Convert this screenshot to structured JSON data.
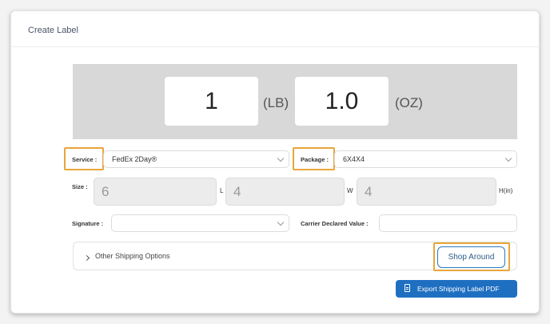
{
  "card": {
    "title": "Create Label"
  },
  "weight": {
    "lb_value": "1",
    "lb_unit": "(LB)",
    "oz_value": "1.0",
    "oz_unit": "(OZ)"
  },
  "service": {
    "label": "Service :",
    "value": "FedEx 2Day®"
  },
  "package": {
    "label": "Package :",
    "value": "6X4X4"
  },
  "size": {
    "label": "Size :",
    "length": "6",
    "length_unit": "L",
    "width": "4",
    "width_unit": "W",
    "height": "4",
    "height_unit": "H(in)"
  },
  "signature": {
    "label": "Signature :",
    "value": ""
  },
  "declared_value": {
    "label": "Carrier Declared Value :",
    "value": ""
  },
  "other_options": {
    "label": "Other Shipping Options"
  },
  "buttons": {
    "shop_around": "Shop Around",
    "export_pdf": "Export Shipping Label PDF"
  },
  "colors": {
    "highlight": "#e8a53b",
    "primary": "#1f6fc1",
    "panel": "#d8d8d8"
  }
}
